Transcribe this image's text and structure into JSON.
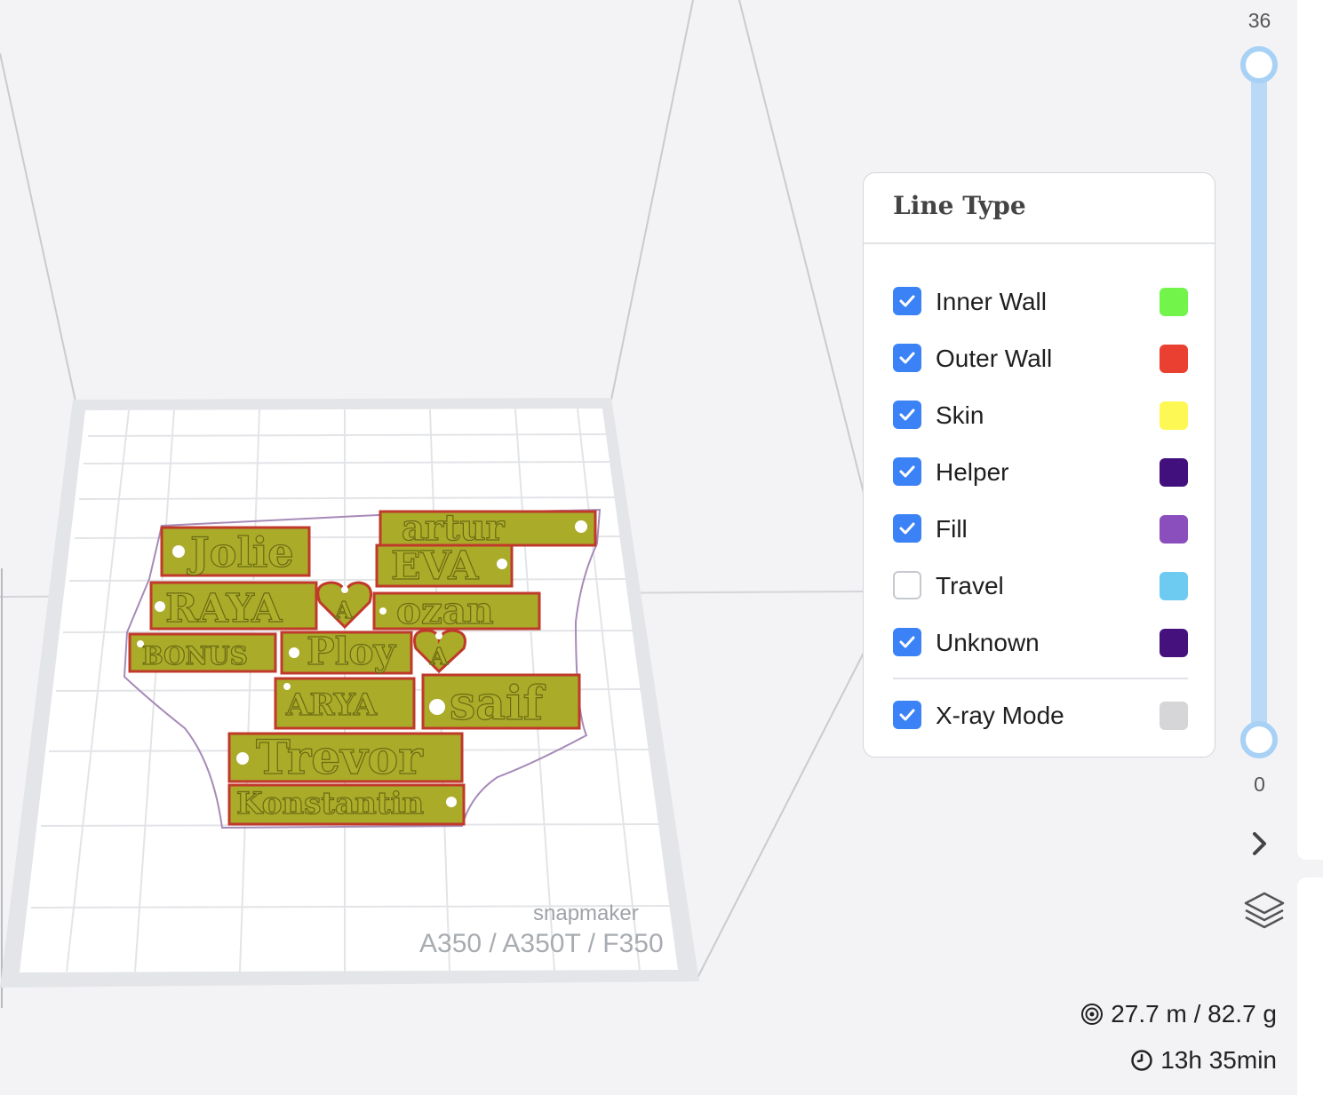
{
  "viewport": {
    "brand": "snapmaker",
    "machine_model": "A350 / A350T / F350",
    "tags": [
      "Jolie",
      "artur",
      "EVA",
      "RAYA",
      "ozan",
      "BONUS",
      "Ploy",
      "ARYA",
      "saif",
      "Trevor",
      "Konstantin"
    ],
    "heart_letter": "A"
  },
  "line_type_panel": {
    "title": "Line Type",
    "items": [
      {
        "label": "Inner Wall",
        "checked": true,
        "color": "#73f44a"
      },
      {
        "label": "Outer Wall",
        "checked": true,
        "color": "#ea4031"
      },
      {
        "label": "Skin",
        "checked": true,
        "color": "#fdf853"
      },
      {
        "label": "Helper",
        "checked": true,
        "color": "#41107c"
      },
      {
        "label": "Fill",
        "checked": true,
        "color": "#8a4fbd"
      },
      {
        "label": "Travel",
        "checked": false,
        "color": "#6dcaf0"
      },
      {
        "label": "Unknown",
        "checked": true,
        "color": "#45117d"
      }
    ],
    "xray": {
      "label": "X-ray Mode",
      "checked": true,
      "color": "#d6d6d9"
    }
  },
  "layer_slider": {
    "max": "36",
    "min": "0",
    "upper_value": 36,
    "lower_value": 0
  },
  "stats": {
    "material": "27.7 m / 82.7 g",
    "time": "13h 35min"
  },
  "icons": {
    "chevron": "chevron-right-icon",
    "layers": "layers-icon",
    "material": "target-icon",
    "time": "clock-icon",
    "checkbox": "check-icon"
  }
}
